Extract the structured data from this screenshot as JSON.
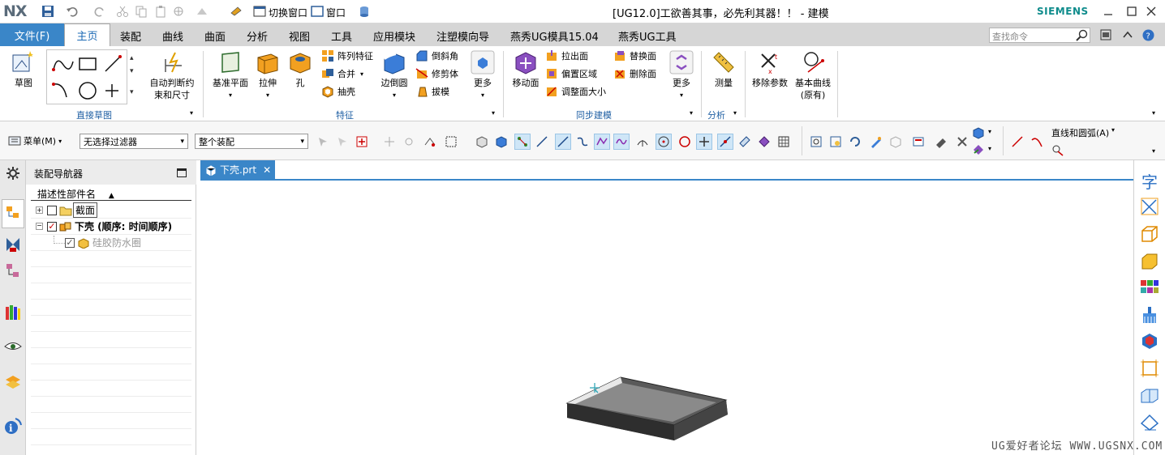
{
  "titlebar": {
    "logo": "NX",
    "title": "[UG12.0]工欲善其事，必先利其器！！ - 建模",
    "brand": "SIEMENS",
    "switch_window": "切换窗口",
    "window": "窗口"
  },
  "tabs": {
    "file": "文件(F)",
    "items": [
      "主页",
      "装配",
      "曲线",
      "曲面",
      "分析",
      "视图",
      "工具",
      "应用模块",
      "注塑模向导",
      "燕秀UG模具15.04",
      "燕秀UG工具"
    ],
    "search_placeholder": "查找命令"
  },
  "ribbon": {
    "sketch": "草图",
    "auto_dim": [
      "自动判断约",
      "束和尺寸"
    ],
    "group_direct_sketch": "直接草图",
    "datum_plane": "基准平面",
    "extrude": "拉伸",
    "hole": "孔",
    "pattern_feature": "阵列特征",
    "unite": "合并",
    "shell": "抽壳",
    "edge_blend": "边倒圆",
    "chamfer": "倒斜角",
    "trim_body": "修剪体",
    "draft": "拔模",
    "more": "更多",
    "group_feature": "特征",
    "move_face": "移动面",
    "pull_face": "拉出面",
    "offset_region": "偏置区域",
    "resize_face": "调整面大小",
    "replace_face": "替换面",
    "delete_face": "删除面",
    "group_sync": "同步建模",
    "measure": "测量",
    "group_analysis": "分析",
    "remove_params": "移除参数",
    "basic_curves": [
      "基本曲线",
      "(原有)"
    ]
  },
  "toolbar": {
    "menu": "菜单(M)",
    "filter": "无选择过滤器",
    "scope": "整个装配",
    "line_arc": "直线和圆弧(A)"
  },
  "navigator": {
    "title": "装配导航器",
    "column": "描述性部件名",
    "rows": [
      {
        "name": "截面",
        "checked": false
      },
      {
        "name": "下壳 (顺序: 时间顺序)",
        "checked": true
      },
      {
        "name": "硅胶防水圈",
        "checked": true
      }
    ]
  },
  "document": {
    "tab": "下壳.prt"
  },
  "watermark": "UG爱好者论坛 WWW.UGSNX.COM",
  "colors": {
    "accent": "#3a86c8",
    "brand": "#0f8c8c",
    "group_label": "#1f5fa3"
  }
}
